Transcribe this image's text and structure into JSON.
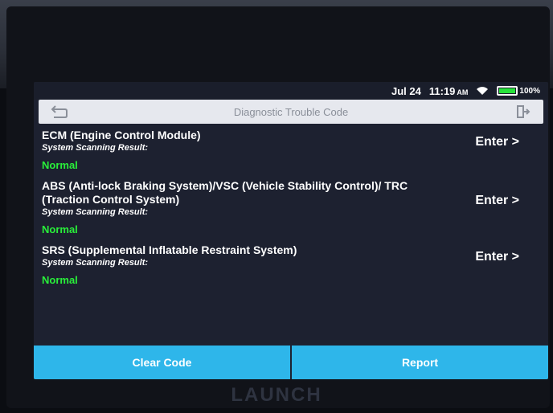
{
  "status": {
    "date": "Jul 24",
    "time": "11:19",
    "ampm": "AM",
    "battery": "100%",
    "battery_level": 1.0
  },
  "header": {
    "title": "Diagnostic Trouble Code"
  },
  "systems": [
    {
      "name": "ECM (Engine Control Module)",
      "result_label": "System Scanning Result:",
      "result": "Normal",
      "enter_label": "Enter >"
    },
    {
      "name": "ABS (Anti-lock Braking System)/VSC (Vehicle Stability Control)/ TRC (Traction Control System)",
      "result_label": "System Scanning Result:",
      "result": "Normal",
      "enter_label": "Enter >"
    },
    {
      "name": "SRS (Supplemental Inflatable Restraint System)",
      "result_label": "System Scanning Result:",
      "result": "Normal",
      "enter_label": "Enter >"
    }
  ],
  "footer": {
    "clear_label": "Clear Code",
    "report_label": "Report"
  },
  "brand": "LAUNCH",
  "colors": {
    "accent": "#2eb6ea",
    "normal": "#29ef3a",
    "screen_bg": "#1d2130"
  }
}
